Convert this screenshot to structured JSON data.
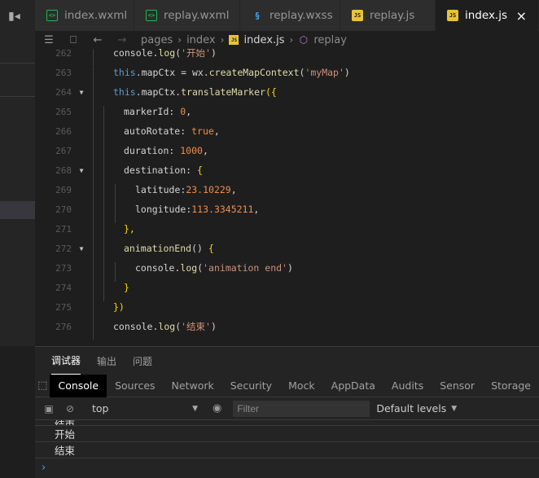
{
  "tabs": [
    {
      "icon": "wxml-icon",
      "label": "index.wxml"
    },
    {
      "icon": "wxml-icon",
      "label": "replay.wxml"
    },
    {
      "icon": "css-icon",
      "label": "replay.wxss"
    },
    {
      "icon": "js-icon",
      "label": "replay.js"
    },
    {
      "icon": "js-icon",
      "label": "index.js",
      "active": true
    }
  ],
  "close_glyph": "×",
  "breadcrumb": {
    "items": [
      "pages",
      "index",
      "index.js",
      "replay"
    ]
  },
  "code": {
    "lines": [
      {
        "n": "262",
        "fold": false
      },
      {
        "n": "263",
        "fold": false
      },
      {
        "n": "264",
        "fold": true
      },
      {
        "n": "265",
        "fold": false
      },
      {
        "n": "266",
        "fold": false
      },
      {
        "n": "267",
        "fold": false
      },
      {
        "n": "268",
        "fold": true
      },
      {
        "n": "269",
        "fold": false
      },
      {
        "n": "270",
        "fold": false
      },
      {
        "n": "271",
        "fold": false
      },
      {
        "n": "272",
        "fold": true
      },
      {
        "n": "273",
        "fold": false
      },
      {
        "n": "274",
        "fold": false
      },
      {
        "n": "275",
        "fold": false
      },
      {
        "n": "276",
        "fold": false
      }
    ],
    "tokens": {
      "l262": [
        "console",
        ".",
        "log",
        "(",
        "'开始'",
        ")"
      ],
      "l263": [
        "this",
        ".mapCtx = wx.",
        "createMapContext",
        "(",
        "'myMap'",
        ")"
      ],
      "l264": [
        "this",
        ".mapCtx.",
        "translateMarker",
        "({"
      ],
      "l265": [
        "markerId",
        ": ",
        "0",
        ","
      ],
      "l266": [
        "autoRotate",
        ": ",
        "true",
        ","
      ],
      "l267": [
        "duration",
        ": ",
        "1000",
        ","
      ],
      "l268": [
        "destination",
        ": ",
        "{"
      ],
      "l269": [
        "latitude",
        ":",
        "23.10229",
        ","
      ],
      "l270": [
        "longitude",
        ":",
        "113.3345211",
        ","
      ],
      "l271": [
        "},"
      ],
      "l272": [
        "animationEnd",
        "() ",
        "{"
      ],
      "l273": [
        "console",
        ".",
        "log",
        "(",
        "'animation end'",
        ")"
      ],
      "l274": [
        "}"
      ],
      "l275": [
        "})"
      ],
      "l276": [
        "console",
        ".",
        "log",
        "(",
        "'结束'",
        ")"
      ]
    }
  },
  "devtools": {
    "top_tabs": [
      "调试器",
      "输出",
      "问题"
    ],
    "panel_tabs": [
      "Console",
      "Sources",
      "Network",
      "Security",
      "Mock",
      "AppData",
      "Audits",
      "Sensor",
      "Storage"
    ],
    "context": "top",
    "filter_placeholder": "Filter",
    "levels": "Default levels",
    "logs": [
      "结束",
      "开始",
      "结束"
    ],
    "prompt": "›"
  },
  "colors": {
    "accent_js": "#e8c23a",
    "wxml": "#2bb24c",
    "css": "#42a5f5",
    "keyword": "#569cd6",
    "function": "#dcdcaa",
    "string": "#ce9178",
    "number": "#f08d49"
  }
}
